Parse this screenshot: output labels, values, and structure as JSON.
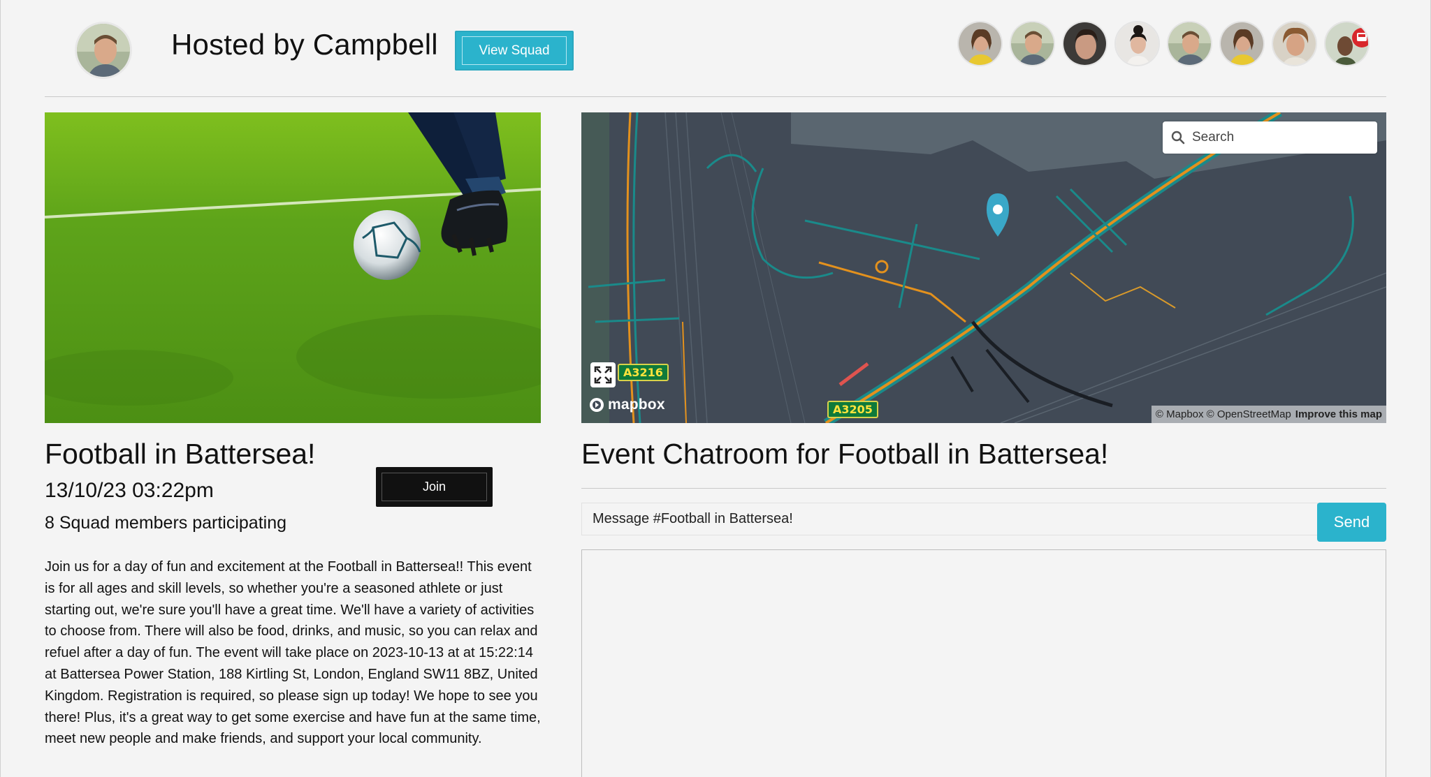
{
  "header": {
    "host_title": "Hosted by Campbell",
    "view_squad_label": "View Squad",
    "squad_member_count": 8
  },
  "event": {
    "title": "Football in Battersea!",
    "datetime": "13/10/23 03:22pm",
    "participants": "8 Squad members participating",
    "join_label": "Join",
    "description": "Join us for a day of fun and excitement at the Football in Battersea!! This event is for all ages and skill levels, so whether you're a seasoned athlete or just starting out, we're sure you'll have a great time. We'll have a variety of activities to choose from. There will also be food, drinks, and music, so you can relax and refuel after a day of fun. The event will take place on 2023-10-13 at at 15:22:14 at Battersea Power Station, 188 Kirtling St, London, England SW11 8BZ, United Kingdom. Registration is required, so please sign up today! We hope to see you there! Plus, it's a great way to get some exercise and have fun at the same time, meet new people and make friends, and support your local community."
  },
  "map": {
    "search_placeholder": "Search",
    "logo": "mapbox",
    "attribution": "© Mapbox © OpenStreetMap",
    "improve_link": "Improve this map",
    "road_labels": [
      "A3216",
      "A3205"
    ],
    "marker_color": "#3aa8c8"
  },
  "chat": {
    "title": "Event Chatroom for Football in Battersea!",
    "input_placeholder": "Message #Football in Battersea!",
    "send_label": "Send"
  },
  "colors": {
    "accent": "#2bb3cc",
    "join_button": "#111111",
    "background": "#f4f4f4"
  }
}
